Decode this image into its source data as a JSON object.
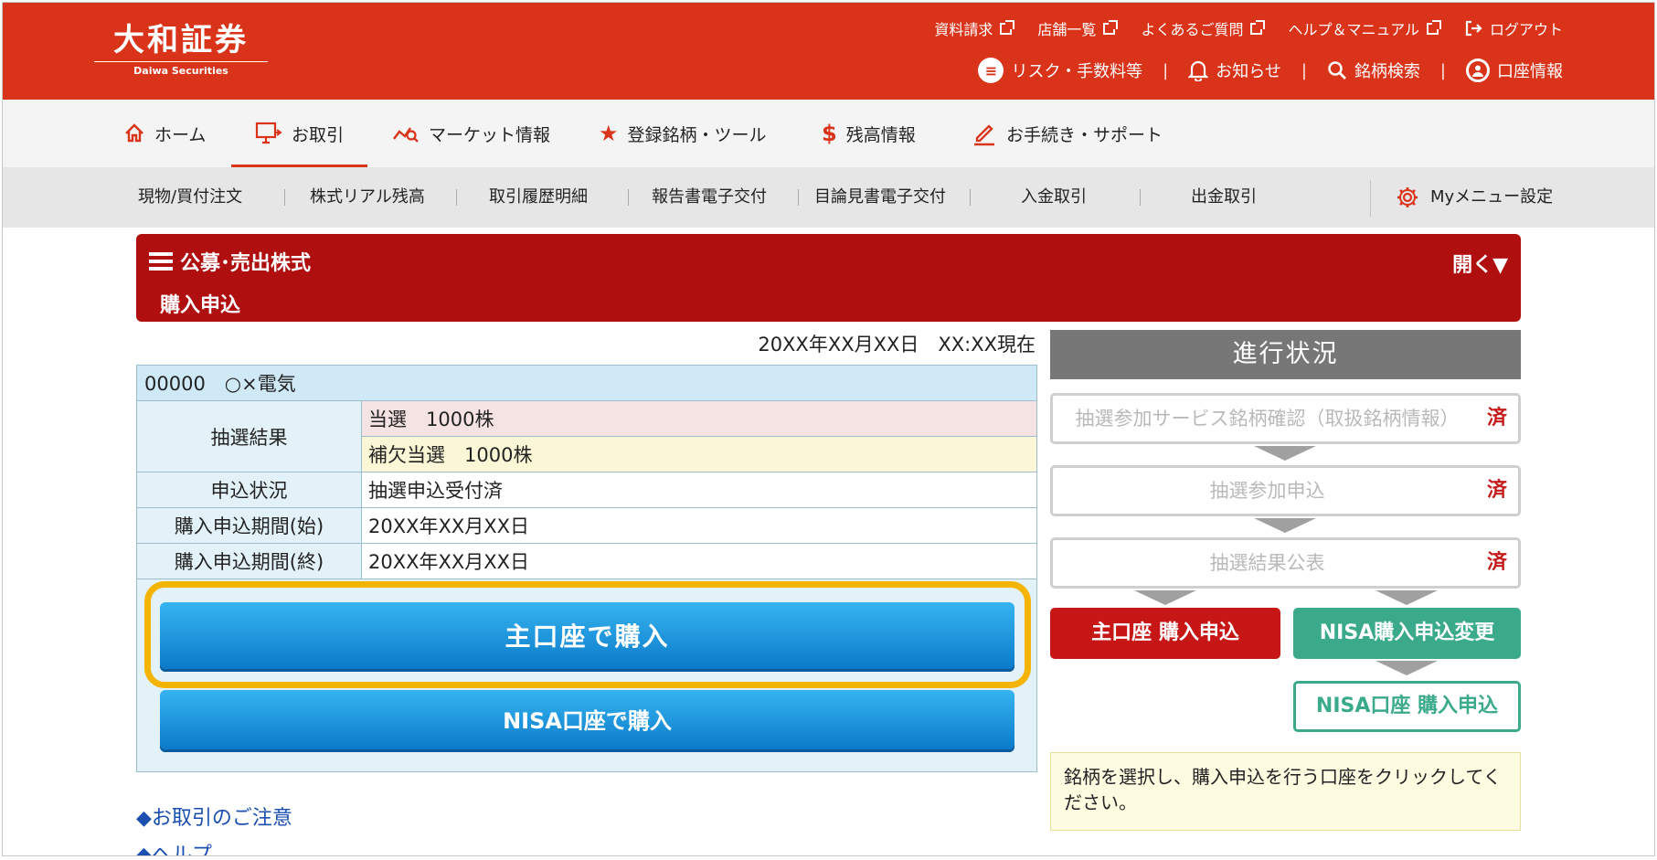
{
  "header": {
    "logo_jp": "大和証券",
    "logo_en": "Daiwa Securities",
    "top_links": [
      "資料請求",
      "店舗一覧",
      "よくあるご質問",
      "ヘルプ＆マニュアル"
    ],
    "logout": "ログアウト",
    "risk": "リスク・手数料等",
    "notice": "お知らせ",
    "search": "銘柄検索",
    "account": "口座情報"
  },
  "nav": {
    "home": "ホーム",
    "trade": "お取引",
    "market": "マーケット情報",
    "register": "登録銘柄・ツール",
    "balance": "残高情報",
    "procedure": "お手続き・サポート"
  },
  "subnav": {
    "items": [
      "現物/買付注文",
      "株式リアル残高",
      "取引履歴明細",
      "報告書電子交付",
      "目論見書電子交付",
      "入金取引",
      "出金取引"
    ],
    "my_menu": "Myメニュー設定"
  },
  "title": {
    "category": "公募･売出株式",
    "page": "購入申込",
    "open": "開く▼"
  },
  "as_of": "20XX年XX月XX日　XX:XX現在",
  "stock": "00000　○×電気",
  "info": {
    "lottery_label": "抽選結果",
    "lottery_1": "当選　1000株",
    "lottery_2": "補欠当選　1000株",
    "status_label": "申込状況",
    "status_value": "抽選申込受付済",
    "start_label": "購入申込期間(始)",
    "start_value": "20XX年XX月XX日",
    "end_label": "購入申込期間(終)",
    "end_value": "20XX年XX月XX日"
  },
  "buttons": {
    "main": "主口座で購入",
    "nisa": "NISA口座で購入"
  },
  "links": {
    "caution": "◆お取引のご注意",
    "help": "◆ヘルプ"
  },
  "progress": {
    "title": "進行状況",
    "steps": [
      {
        "label": "抽選参加サービス銘柄確認（取扱銘柄情報）",
        "done": "済"
      },
      {
        "label": "抽選参加申込",
        "done": "済"
      },
      {
        "label": "抽選結果公表",
        "done": "済"
      }
    ],
    "main_apply": "主口座 購入申込",
    "nisa_change": "NISA購入申込変更",
    "nisa_apply": "NISA口座 購入申込",
    "note": "銘柄を選択し、購入申込を行う口座をクリックしてください。"
  },
  "colors": {
    "brand": "#d9331a",
    "title_bar": "#b00f0f",
    "button_blue": "#0a78c8",
    "highlight": "#f5b400",
    "nisa_green": "#3aaa8a"
  }
}
